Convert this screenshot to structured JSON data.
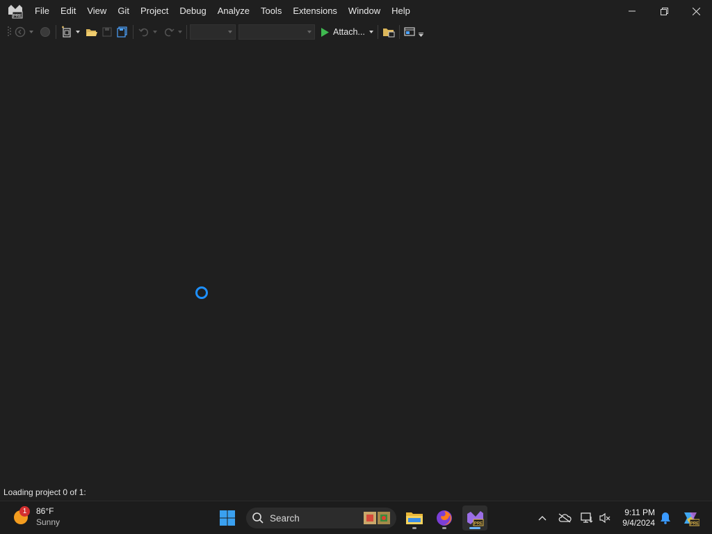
{
  "app": {
    "logo_badge": "PRE"
  },
  "menu": {
    "items": [
      "File",
      "Edit",
      "View",
      "Git",
      "Project",
      "Debug",
      "Analyze",
      "Tools",
      "Extensions",
      "Window",
      "Help"
    ]
  },
  "toolbar": {
    "attach_label": "Attach...",
    "config_combo_value": "",
    "platform_combo_value": ""
  },
  "status": {
    "text": "Loading project 0 of 1:"
  },
  "taskbar": {
    "weather": {
      "temperature": "86°F",
      "condition": "Sunny",
      "alert_count": "1"
    },
    "search": {
      "label": "Search"
    },
    "clock": {
      "time": "9:11 PM",
      "date": "9/4/2024"
    },
    "copilot_badge": "PRE",
    "vs_badge": "PRE"
  },
  "colors": {
    "background": "#1f1f1f",
    "accent": "#1e90ff",
    "run_green": "#3fb950",
    "taskbar": "#1c1c1c"
  }
}
